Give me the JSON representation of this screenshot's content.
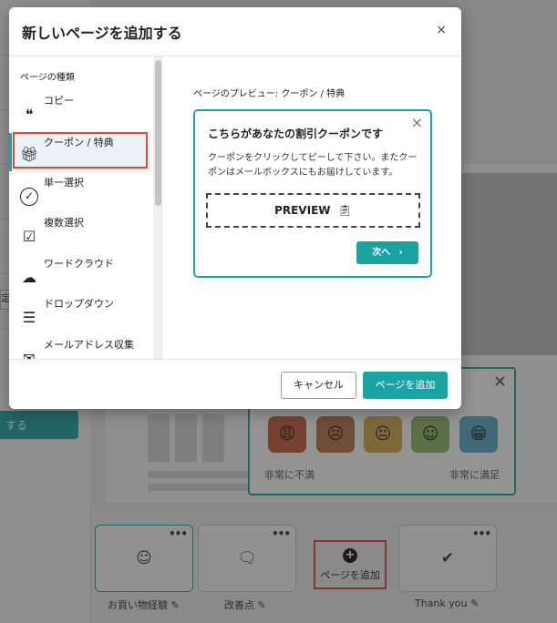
{
  "modal": {
    "title": "新しいページを追加する",
    "close_glyph": "×",
    "sidebar": {
      "heading": "ページの種類",
      "items": [
        {
          "label": "コピー",
          "icon": "quote-icon",
          "glyph": "❝"
        },
        {
          "label": "クーポン / 特典",
          "icon": "gift-icon",
          "glyph": "🎁︎"
        },
        {
          "label": "単一選択",
          "icon": "check-circle-icon",
          "glyph": "✓"
        },
        {
          "label": "複数選択",
          "icon": "checkbox-multi-icon",
          "glyph": "☑"
        },
        {
          "label": "ワードクラウド",
          "icon": "cloud-icon",
          "glyph": "☁"
        },
        {
          "label": "ドロップダウン",
          "icon": "dropdown-list-icon",
          "glyph": "☰"
        },
        {
          "label": "メールアドレス収集",
          "icon": "mail-icon",
          "glyph": "✉"
        }
      ],
      "selected_index": 1
    },
    "preview": {
      "label": "ページのプレビュー: クーポン / 特典",
      "coupon": {
        "title": "こちらがあなたの割引クーポンです",
        "description": "クーポンをクリックしてピーして下さい。またクーポンはメールボックスにもお届けしています。",
        "preview_text": "PREVIEW",
        "next_label": "次へ",
        "close_glyph": "×"
      }
    },
    "footer": {
      "cancel_label": "キャンセル",
      "add_label": "ページを追加"
    }
  },
  "background": {
    "left_button_label": "する",
    "left_tag_label": "定",
    "survey": {
      "low_label": "非常に不満",
      "high_label": "非常に満足",
      "faces": [
        {
          "color": "#c65a3a",
          "glyph": "😩︎"
        },
        {
          "color": "#b8704a",
          "glyph": "☹"
        },
        {
          "color": "#d1a94a",
          "glyph": "😐︎"
        },
        {
          "color": "#8fb861",
          "glyph": "☺"
        },
        {
          "color": "#5aa7c8",
          "glyph": "😁︎"
        }
      ]
    },
    "pages": [
      {
        "caption": "お買い物経験",
        "icon": "smiley-icon",
        "glyph": "☺"
      },
      {
        "caption": "改善点",
        "icon": "comment-icon",
        "glyph": "🗨︎"
      },
      {
        "caption": "Thank you",
        "icon": "checkmark-icon",
        "glyph": "✔"
      }
    ],
    "add_page_label": "ページを追加"
  },
  "colors": {
    "accent": "#1aa3a3",
    "highlight": "#e8452c"
  }
}
